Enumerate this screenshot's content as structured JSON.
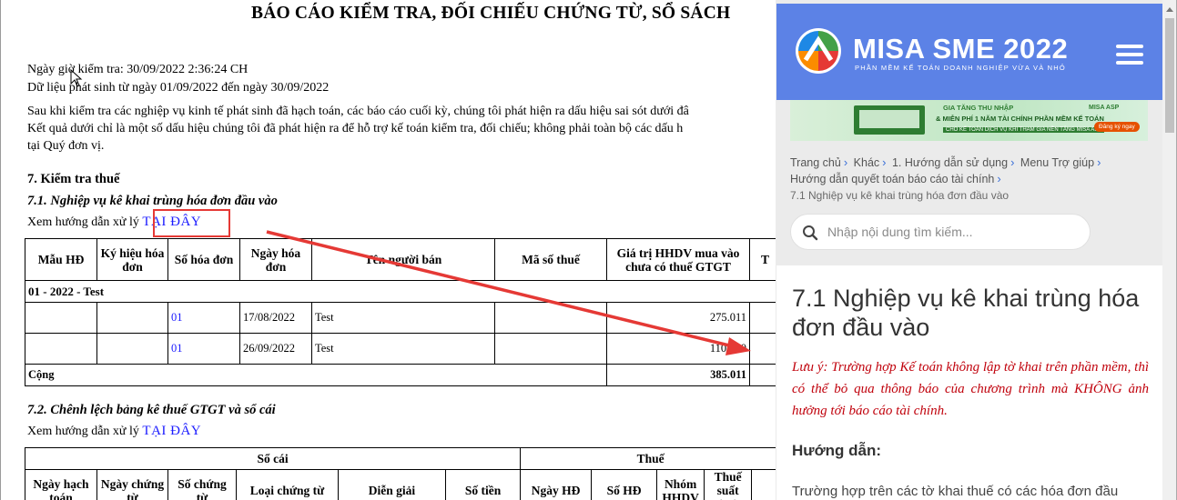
{
  "report": {
    "title": "BÁO CÁO KIỂM TRA, ĐỐI CHIẾU CHỨNG TỪ, SỔ SÁCH",
    "checked_at": "Ngày giờ kiểm tra: 30/09/2022 2:36:24 CH",
    "data_range": "Dữ liệu phát sinh từ ngày 01/09/2022 đến ngày 30/09/2022",
    "intro_1": "Sau khi kiểm tra các nghiệp vụ kinh tế phát sinh đã hạch toán, các báo cáo cuối kỳ, chúng tôi phát hiện ra dấu hiệu sai sót dưới đâ",
    "intro_2": "Kết quả dưới chỉ là một số dấu hiệu chúng tôi đã phát hiện ra để hỗ trợ kế toán kiểm tra, đối chiếu; không phải toàn bộ các dấu h",
    "intro_3": "tại Quý đơn vị.",
    "section_7": "7. Kiểm tra thuế",
    "section_71": "7.1. Nghiệp vụ kê khai trùng hóa đơn đầu vào",
    "guide_prefix": "Xem hướng dẫn xử lý",
    "guide_link": "TẠI ĐÂY",
    "table1": {
      "headers": [
        "Mẫu HĐ",
        "Ký hiệu hóa đơn",
        "Số hóa đơn",
        "Ngày hóa đơn",
        "Tên người bán",
        "Mã số thuế",
        "Giá trị HHDV mua vào chưa có thuế GTGT",
        "T"
      ],
      "group": "01 - 2022 - Test",
      "rows": [
        {
          "invoice_no": "01",
          "date": "17/08/2022",
          "seller": "Test",
          "value": "275.011"
        },
        {
          "invoice_no": "01",
          "date": "26/09/2022",
          "seller": "Test",
          "value": "110.000"
        }
      ],
      "total_label": "Cộng",
      "total_value": "385.011"
    },
    "section_72": "7.2. Chênh lệch bảng kê thuế GTGT và sổ cái",
    "guide_prefix_2": "Xem hướng dẫn xử lý",
    "guide_link_2": "TẠI ĐÂY",
    "table2": {
      "group_ledger": "Sổ cái",
      "group_tax": "Thuế",
      "headers": [
        "Ngày hạch toán",
        "Ngày chứng từ",
        "Số chứng từ",
        "Loại chứng từ",
        "Diễn giải",
        "Số tiền",
        "Ngày HĐ",
        "Số HĐ",
        "Nhóm HHDV",
        "Thuế suất (%)"
      ]
    }
  },
  "panel": {
    "brand": "MISA SME 2022",
    "tagline": "PHẦN MỀM KẾ TOÁN DOANH NGHIỆP VỪA VÀ NHỎ",
    "banner": {
      "line1": "GIA TĂNG THU NHẬP",
      "line2": "& MIỄN PHÍ 1 NĂM TÀI CHÍNH PHẦN MỀM KẾ TOÁN",
      "line3": "CHO KẾ TOÁN DỊCH VỤ KHI THAM GIA NỀN TẢNG MISA ASP",
      "logo": "MISA ASP",
      "cta": "Đăng ký ngay"
    },
    "breadcrumb": [
      "Trang chủ",
      "Khác",
      "1. Hướng dẫn sử dụng",
      "Menu Trợ giúp",
      "Hướng dẫn quyết toán báo cáo tài chính"
    ],
    "breadcrumb_current": "7.1 Nghiệp vụ kê khai trùng hóa đơn đầu vào",
    "search_placeholder": "Nhập nội dung tìm kiếm...",
    "article_title": "7.1 Nghiệp vụ kê khai trùng hóa đơn đầu vào",
    "note": "Lưu ý: Trường hợp Kế toán không lập tờ khai trên phần mềm, thì có thể bỏ qua thông báo của chương trình mà KHÔNG ảnh hưởng tới báo cáo tài chính.",
    "guide_heading": "Hướng dẫn:",
    "paragraph_start": "Trường hợp trên các tờ khai thuế có các hóa đơn đầu"
  },
  "colors": {
    "header_blue": "#5c82e6",
    "highlight_red": "#e53935",
    "link_blue": "#1a1aff",
    "note_red": "#c0000b"
  }
}
